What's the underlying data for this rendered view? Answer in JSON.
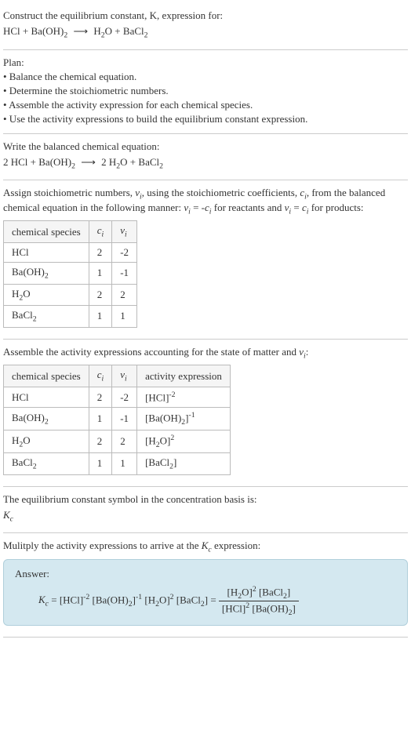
{
  "header": {
    "prompt": "Construct the equilibrium constant, K, expression for:",
    "equation": "HCl + Ba(OH)₂  ⟶  H₂O + BaCl₂"
  },
  "plan": {
    "title": "Plan:",
    "items": [
      "• Balance the chemical equation.",
      "• Determine the stoichiometric numbers.",
      "• Assemble the activity expression for each chemical species.",
      "• Use the activity expressions to build the equilibrium constant expression."
    ]
  },
  "balanced": {
    "title": "Write the balanced chemical equation:",
    "equation": "2 HCl + Ba(OH)₂  ⟶  2 H₂O + BaCl₂"
  },
  "stoich": {
    "intro_a": "Assign stoichiometric numbers, ",
    "intro_b": ", using the stoichiometric coefficients, ",
    "intro_c": ", from the balanced chemical equation in the following manner: ",
    "intro_d": " for reactants and ",
    "intro_e": " for products:",
    "head_species": "chemical species",
    "head_ci": "cᵢ",
    "head_vi": "νᵢ",
    "rows": [
      {
        "species": "HCl",
        "ci": "2",
        "vi": "-2"
      },
      {
        "species": "Ba(OH)₂",
        "ci": "1",
        "vi": "-1"
      },
      {
        "species": "H₂O",
        "ci": "2",
        "vi": "2"
      },
      {
        "species": "BaCl₂",
        "ci": "1",
        "vi": "1"
      }
    ]
  },
  "activity": {
    "intro": "Assemble the activity expressions accounting for the state of matter and νᵢ:",
    "head_species": "chemical species",
    "head_ci": "cᵢ",
    "head_vi": "νᵢ",
    "head_expr": "activity expression",
    "rows": [
      {
        "species": "HCl",
        "ci": "2",
        "vi": "-2",
        "expr": "[HCl]⁻²"
      },
      {
        "species": "Ba(OH)₂",
        "ci": "1",
        "vi": "-1",
        "expr": "[Ba(OH)₂]⁻¹"
      },
      {
        "species": "H₂O",
        "ci": "2",
        "vi": "2",
        "expr": "[H₂O]²"
      },
      {
        "species": "BaCl₂",
        "ci": "1",
        "vi": "1",
        "expr": "[BaCl₂]"
      }
    ]
  },
  "symbol": {
    "text": "The equilibrium constant symbol in the concentration basis is:",
    "value": "K_c"
  },
  "multiply": {
    "text": "Mulitply the activity expressions to arrive at the K_c expression:"
  },
  "answer": {
    "label": "Answer:",
    "lhs": "K_c = [HCl]⁻² [Ba(OH)₂]⁻¹ [H₂O]² [BaCl₂] = ",
    "num": "[H₂O]² [BaCl₂]",
    "den": "[HCl]² [Ba(OH)₂]"
  },
  "chart_data": {
    "type": "table",
    "tables": [
      {
        "title": "Stoichiometric numbers",
        "columns": [
          "chemical species",
          "cᵢ",
          "νᵢ"
        ],
        "rows": [
          [
            "HCl",
            2,
            -2
          ],
          [
            "Ba(OH)₂",
            1,
            -1
          ],
          [
            "H₂O",
            2,
            2
          ],
          [
            "BaCl₂",
            1,
            1
          ]
        ]
      },
      {
        "title": "Activity expressions",
        "columns": [
          "chemical species",
          "cᵢ",
          "νᵢ",
          "activity expression"
        ],
        "rows": [
          [
            "HCl",
            2,
            -2,
            "[HCl]^-2"
          ],
          [
            "Ba(OH)₂",
            1,
            -1,
            "[Ba(OH)₂]^-1"
          ],
          [
            "H₂O",
            2,
            2,
            "[H₂O]^2"
          ],
          [
            "BaCl₂",
            1,
            1,
            "[BaCl₂]"
          ]
        ]
      }
    ]
  }
}
